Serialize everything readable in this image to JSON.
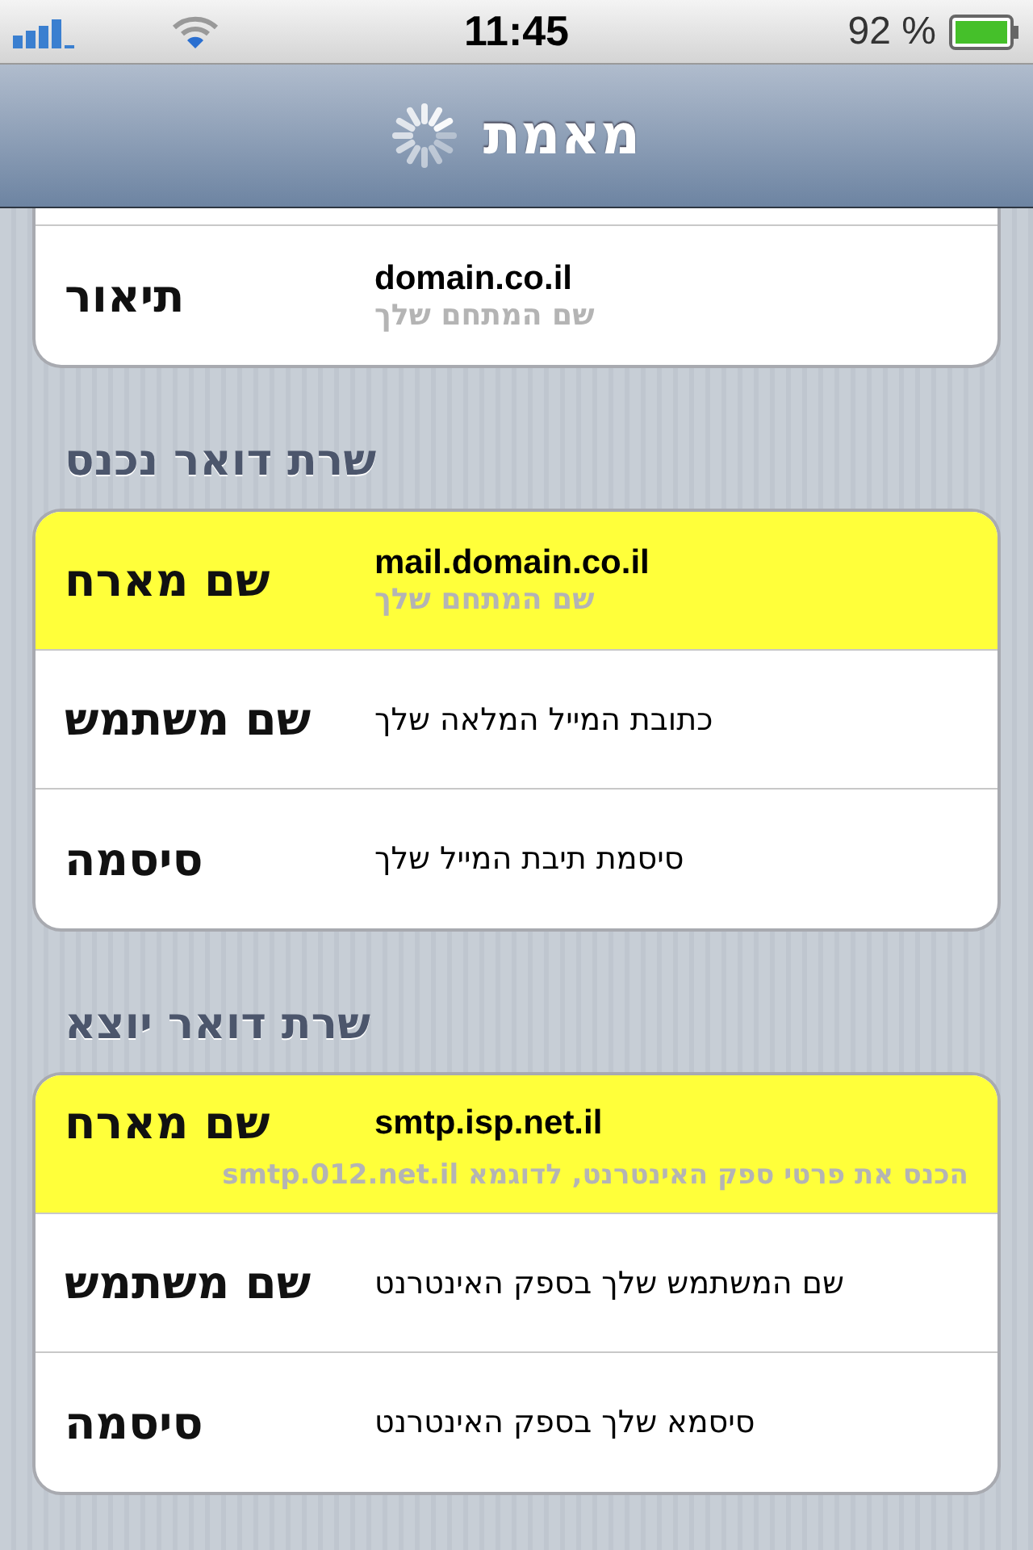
{
  "status_bar": {
    "time": "11:45",
    "battery": "92 %"
  },
  "nav_bar": {
    "title": "מאמת",
    "loading": true
  },
  "groups": [
    {
      "cut_top": true,
      "rows": [
        {
          "label": "תיאור",
          "value": "domain.co.il",
          "hint": "שם המתחם שלך",
          "hint_wide": false,
          "highlighted": false
        }
      ]
    },
    {
      "header": "שרת דואר נכנס",
      "cut_top": false,
      "rows": [
        {
          "label": "שם מארח",
          "value": "mail.domain.co.il",
          "hint": "שם המתחם שלך",
          "hint_wide": false,
          "highlighted": true
        },
        {
          "label": "שם משתמש",
          "value": "כתובת המייל המלאה שלך",
          "highlighted": false
        },
        {
          "label": "סיסמה",
          "value": "סיסמת תיבת המייל שלך",
          "highlighted": false
        }
      ]
    },
    {
      "header": "שרת דואר יוצא",
      "cut_top": false,
      "rows": [
        {
          "label": "שם מארח",
          "value": "smtp.isp.net.il",
          "hint": "הכנס את פרטי ספק האינטרנט, לדוגמא **smtp**.012.**net.il**",
          "hint_wide": true,
          "highlighted": true
        },
        {
          "label": "שם משתמש",
          "value": "שם המשתמש שלך בספק האינטרנט",
          "highlighted": false
        },
        {
          "label": "סיסמה",
          "value": "סיסמא שלך בספק האינטרנט",
          "highlighted": false
        }
      ]
    }
  ]
}
